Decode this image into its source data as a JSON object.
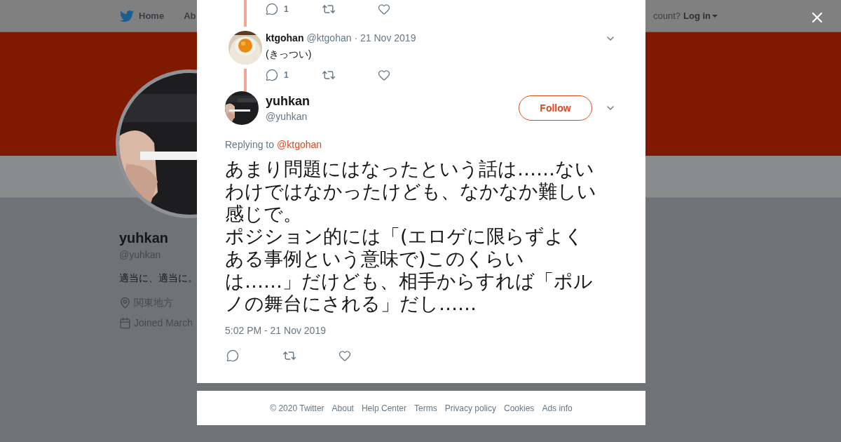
{
  "background_page": {
    "nav": {
      "items": [
        "Home",
        "Ab"
      ],
      "account_prompt": "count?",
      "login": "Log in"
    },
    "profile": {
      "name": "yuhkan",
      "handle": "@yuhkan",
      "bio": "適当に、適当に。",
      "location": "関東地方",
      "joined": "Joined March"
    }
  },
  "modal": {
    "thread": [
      {
        "kind": "actions",
        "reply_count": "1"
      },
      {
        "kind": "tweet",
        "name": "ktgohan",
        "handle": "@ktgohan",
        "date": "· 21 Nov 2019",
        "text": "(きっつい)",
        "reply_count": "1"
      }
    ],
    "main_tweet": {
      "name": "yuhkan",
      "handle": "@yuhkan",
      "follow_label": "Follow",
      "replying_prefix": "Replying to",
      "replying_to": "@ktgohan",
      "paragraphs": [
        "あまり問題にはなったという話は……ないわけではなかったけども、なかなか難しい感じで。",
        "ポジション的には「(エロゲに限らずよくある事例という意味で)このくらいは……」だけども、相手からすれば「ポルノの舞台にされる」だし……"
      ],
      "timestamp": "5:02 PM - 21 Nov 2019"
    }
  },
  "footer": [
    "© 2020 Twitter",
    "About",
    "Help Center",
    "Terms",
    "Privacy policy",
    "Cookies",
    "Ads info"
  ]
}
